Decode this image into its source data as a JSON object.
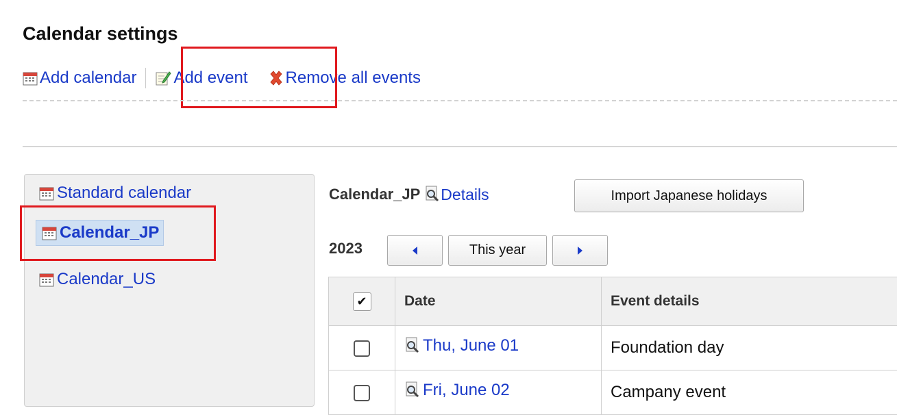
{
  "page": {
    "title": "Calendar settings"
  },
  "actions": {
    "add_calendar": "Add calendar",
    "add_event": "Add event",
    "remove_all_events": "Remove all events"
  },
  "sidebar": {
    "items": [
      {
        "label": "Standard calendar",
        "selected": false
      },
      {
        "label": "Calendar_JP",
        "selected": true
      },
      {
        "label": "Calendar_US",
        "selected": false
      }
    ]
  },
  "calendar": {
    "name": "Calendar_JP",
    "details_label": "Details",
    "import_button": "Import Japanese holidays",
    "year": "2023",
    "this_year_button": "This year"
  },
  "table": {
    "headers": {
      "check": "✔",
      "date": "Date",
      "event": "Event details"
    },
    "rows": [
      {
        "date": "Thu, June 01",
        "event": "Foundation day"
      },
      {
        "date": "Fri, June 02",
        "event": "Campany event"
      }
    ]
  },
  "colors": {
    "link": "#1a3ac8",
    "highlight": "#e0191e",
    "selected_bg": "#cfe0f3"
  }
}
